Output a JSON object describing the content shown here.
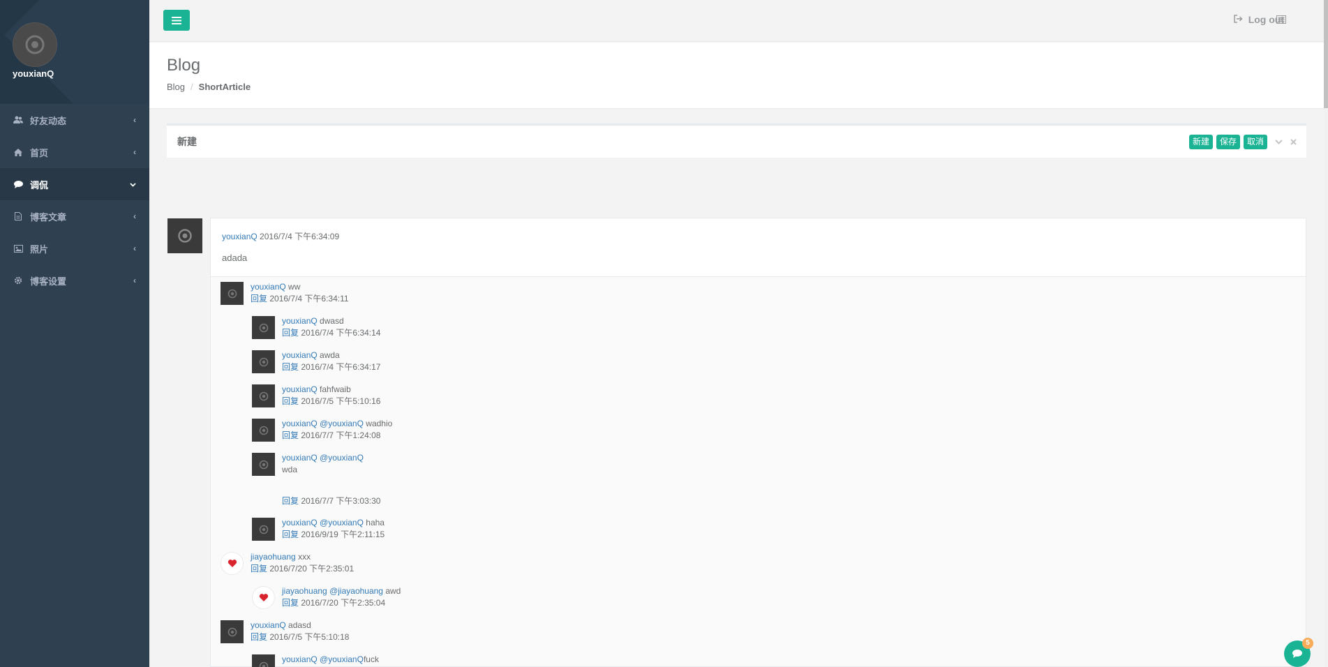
{
  "sidebar": {
    "username": "youxianQ",
    "items": [
      {
        "label": "好友动态",
        "icon": "users-icon",
        "active": false
      },
      {
        "label": "首页",
        "icon": "home-icon",
        "active": false
      },
      {
        "label": "调侃",
        "icon": "comment-icon",
        "active": true
      },
      {
        "label": "博客文章",
        "icon": "file-icon",
        "active": false
      },
      {
        "label": "照片",
        "icon": "image-icon",
        "active": false
      },
      {
        "label": "博客设置",
        "icon": "gear-icon",
        "active": false
      }
    ]
  },
  "topbar": {
    "logout_label": "Log out"
  },
  "heading": {
    "title": "Blog",
    "breadcrumb": [
      "Blog",
      "ShortArticle"
    ]
  },
  "ibox": {
    "title": "新建",
    "buttons": [
      "新建",
      "保存",
      "取消"
    ]
  },
  "post": {
    "author": "youxianQ",
    "date": "2016/7/4 下午6:34:09",
    "content": "adada"
  },
  "reply_label": "回复",
  "comments": [
    {
      "author": "youxianQ",
      "mention": "",
      "text": "ww",
      "date": "2016/7/4 下午6:34:11",
      "level": 0,
      "avatar": "chrome"
    },
    {
      "author": "youxianQ",
      "mention": "",
      "text": "dwasd",
      "date": "2016/7/4 下午6:34:14",
      "level": 1,
      "avatar": "chrome"
    },
    {
      "author": "youxianQ",
      "mention": "",
      "text": "awda",
      "date": "2016/7/4 下午6:34:17",
      "level": 1,
      "avatar": "chrome"
    },
    {
      "author": "youxianQ",
      "mention": "",
      "text": "fahfwaib",
      "date": "2016/7/5 下午5:10:16",
      "level": 1,
      "avatar": "chrome"
    },
    {
      "author": "youxianQ",
      "mention": "@youxianQ",
      "text": "wadhio",
      "date": "2016/7/7 下午1:24:08",
      "level": 1,
      "avatar": "chrome"
    },
    {
      "author": "youxianQ",
      "mention": "@youxianQ",
      "text": "wda",
      "date": "2016/7/7 下午3:03:30",
      "level": 1,
      "avatar": "chrome",
      "multiline": true
    },
    {
      "author": "youxianQ",
      "mention": "@youxianQ",
      "text": "haha",
      "date": "2016/9/19 下午2:11:15",
      "level": 1,
      "avatar": "chrome"
    },
    {
      "author": "jiayaohuang",
      "mention": "",
      "text": "xxx",
      "date": "2016/7/20 下午2:35:01",
      "level": 0,
      "avatar": "heart"
    },
    {
      "author": "jiayaohuang",
      "mention": "@jiayaohuang",
      "text": "awd",
      "date": "2016/7/20 下午2:35:04",
      "level": 1,
      "avatar": "heart"
    },
    {
      "author": "youxianQ",
      "mention": "",
      "text": "adasd",
      "date": "2016/7/5 下午5:10:18",
      "level": 0,
      "avatar": "chrome"
    },
    {
      "author": "youxianQ",
      "mention": "@youxianQ",
      "text": "fuck",
      "date": "",
      "level": 1,
      "avatar": "chrome"
    }
  ],
  "chat": {
    "badge": "5"
  },
  "colors": {
    "accent": "#1ab394",
    "sidebar": "#2f4050",
    "link": "#337ab7",
    "badge": "#f8ac59"
  }
}
